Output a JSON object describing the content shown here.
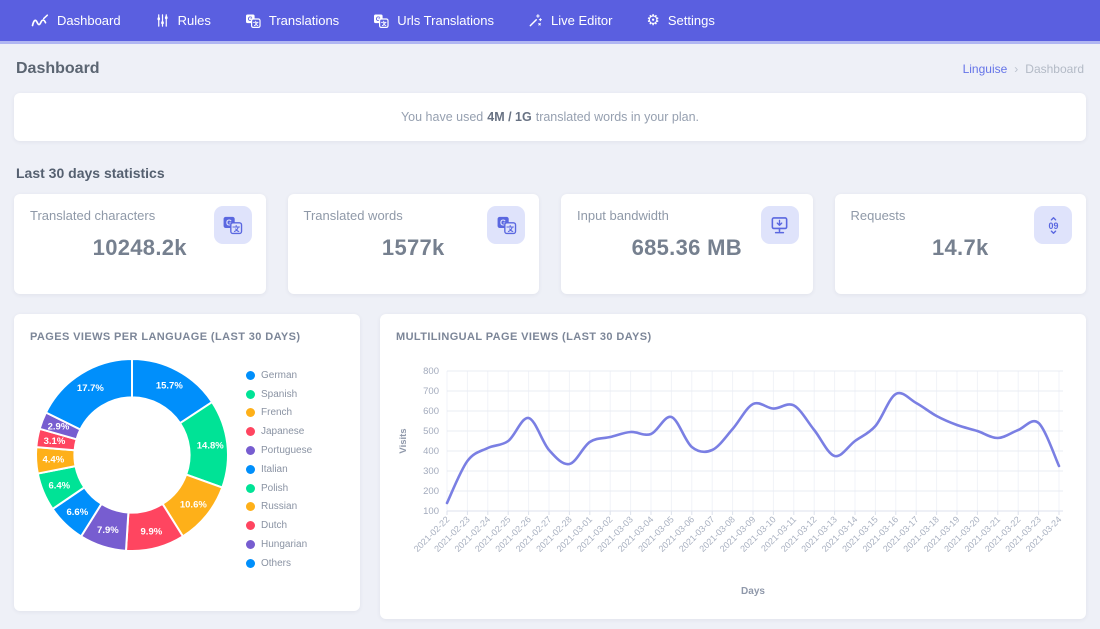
{
  "nav": {
    "items": [
      {
        "label": "Dashboard",
        "icon": "brand-logo-icon"
      },
      {
        "label": "Rules",
        "icon": "sliders-icon"
      },
      {
        "label": "Translations",
        "icon": "translate-icon"
      },
      {
        "label": "Urls Translations",
        "icon": "translate-icon"
      },
      {
        "label": "Live Editor",
        "icon": "wand-icon"
      },
      {
        "label": "Settings",
        "icon": "gear-icon"
      }
    ]
  },
  "header": {
    "title": "Dashboard"
  },
  "breadcrumb": {
    "link": "Linguise",
    "separator": "›",
    "current": "Dashboard"
  },
  "notice": {
    "prefix": "You have used",
    "highlight": "4M / 1G",
    "suffix": "translated words in your plan."
  },
  "stats": {
    "heading": "Last 30 days statistics",
    "cards": [
      {
        "label": "Translated characters",
        "value": "10248.2k",
        "icon": "translate-icon"
      },
      {
        "label": "Translated words",
        "value": "1577k",
        "icon": "translate-icon"
      },
      {
        "label": "Input bandwidth",
        "value": "685.36 MB",
        "icon": "bandwidth-icon"
      },
      {
        "label": "Requests",
        "value": "14.7k",
        "icon": "requests-icon"
      }
    ]
  },
  "theme": {
    "navbar_color": "#5a5fe0",
    "accent_color": "#5a67e0",
    "icon_badge_bg": "#dfe3fb",
    "line_color": "#7a7fe3"
  },
  "chart_data": [
    {
      "type": "pie",
      "subtype": "donut",
      "title": "PAGES VIEWS PER LANGUAGE (LAST 30 DAYS)",
      "labels": [
        "German",
        "Spanish",
        "French",
        "Japanese",
        "Portuguese",
        "Italian",
        "Polish",
        "Russian",
        "Dutch",
        "Hungarian",
        "Others"
      ],
      "values": [
        15.7,
        14.8,
        10.6,
        9.9,
        7.9,
        6.6,
        6.4,
        4.4,
        3.1,
        2.9,
        17.7
      ],
      "unit": "%",
      "colors": [
        "#008FFB",
        "#00E396",
        "#FEB019",
        "#FF4560",
        "#775DD0"
      ],
      "hole_ratio": 0.6,
      "legend_position": "right"
    },
    {
      "type": "line",
      "title": "MULTILINGUAL PAGE VIEWS (LAST 30 DAYS)",
      "x": [
        "2021-02-22",
        "2021-02-23",
        "2021-02-24",
        "2021-02-25",
        "2021-02-26",
        "2021-02-27",
        "2021-02-28",
        "2021-03-01",
        "2021-03-02",
        "2021-03-03",
        "2021-03-04",
        "2021-03-05",
        "2021-03-06",
        "2021-03-07",
        "2021-03-08",
        "2021-03-09",
        "2021-03-10",
        "2021-03-11",
        "2021-03-12",
        "2021-03-13",
        "2021-03-14",
        "2021-03-15",
        "2021-03-16",
        "2021-03-17",
        "2021-03-18",
        "2021-03-19",
        "2021-03-20",
        "2021-03-21",
        "2021-03-22",
        "2021-03-23",
        "2021-03-24"
      ],
      "values": [
        140,
        350,
        415,
        450,
        565,
        405,
        335,
        445,
        470,
        495,
        485,
        570,
        420,
        405,
        510,
        635,
        612,
        628,
        505,
        375,
        450,
        525,
        685,
        640,
        575,
        530,
        500,
        465,
        505,
        540,
        325
      ],
      "xlabel": "Days",
      "ylabel": "Visits",
      "ylim": [
        100,
        800
      ],
      "ytick_step": 100,
      "grid": true,
      "smooth": true,
      "color": "#7a7fe3"
    }
  ]
}
